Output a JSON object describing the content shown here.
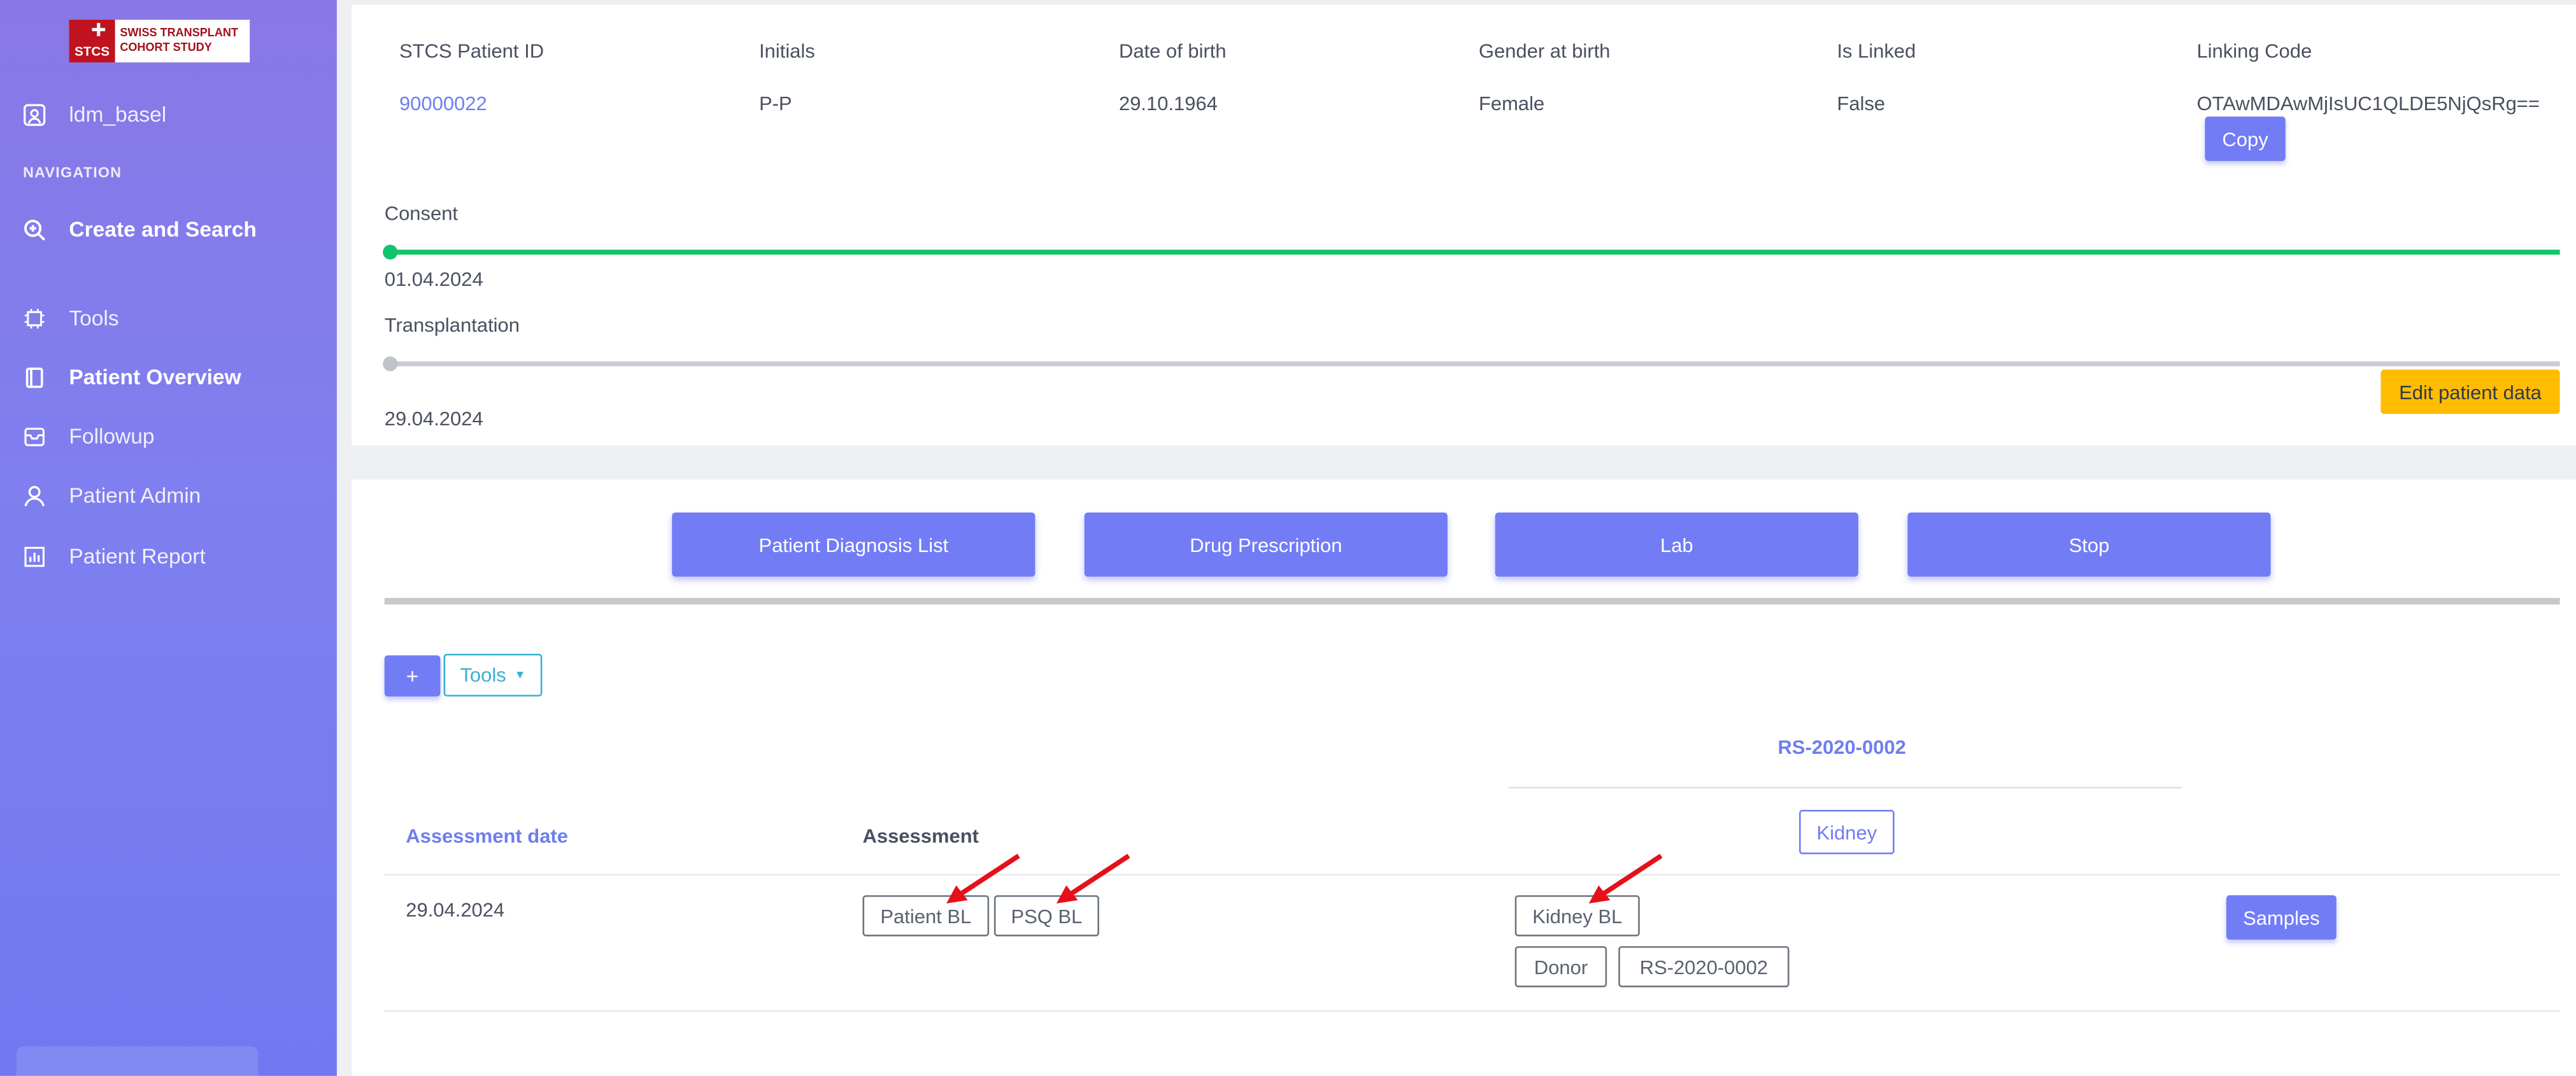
{
  "sidebar": {
    "logo": {
      "mark": "STCS",
      "line1": "SWISS TRANSPLANT",
      "line2": "COHORT STUDY"
    },
    "user": "ldm_basel",
    "nav_heading": "NAVIGATION",
    "items": [
      {
        "label": "Create and Search",
        "icon": "search-plus-icon"
      },
      {
        "label": "Tools",
        "icon": "chip-icon"
      },
      {
        "label": "Patient Overview",
        "icon": "book-icon"
      },
      {
        "label": "Followup",
        "icon": "inbox-icon"
      },
      {
        "label": "Patient Admin",
        "icon": "user-icon"
      },
      {
        "label": "Patient Report",
        "icon": "chart-icon"
      }
    ]
  },
  "patient": {
    "headers": [
      "STCS Patient ID",
      "Initials",
      "Date of birth",
      "Gender at birth",
      "Is Linked",
      "Linking Code"
    ],
    "id": "90000022",
    "initials": "P-P",
    "dob": "29.10.1964",
    "gender": "Female",
    "is_linked": "False",
    "linking_code": "OTAwMDAwMjIsUC1QLDE5NjQsRg==",
    "copy_label": "Copy"
  },
  "consent": {
    "label": "Consent",
    "date": "01.04.2024"
  },
  "transplantation": {
    "label": "Transplantation",
    "date": "29.04.2024"
  },
  "edit_label": "Edit patient data",
  "tabs": [
    "Patient Diagnosis List",
    "Drug Prescription",
    "Lab",
    "Stop"
  ],
  "toolbar": {
    "add_label": "+",
    "tools_label": "Tools"
  },
  "table": {
    "group_header": "RS-2020-0002",
    "group_tag": "Kidney",
    "col_date": "Assessment date",
    "col_assessment": "Assessment",
    "row": {
      "date": "29.04.2024",
      "assessments": [
        "Patient BL",
        "PSQ BL"
      ],
      "group_items": [
        "Kidney BL",
        "Donor",
        "RS-2020-0002"
      ],
      "samples_label": "Samples"
    }
  },
  "colors": {
    "accent": "#727cf5",
    "warning": "#ffbc00",
    "consent_line": "#10c469",
    "arrow": "#e6101a"
  }
}
